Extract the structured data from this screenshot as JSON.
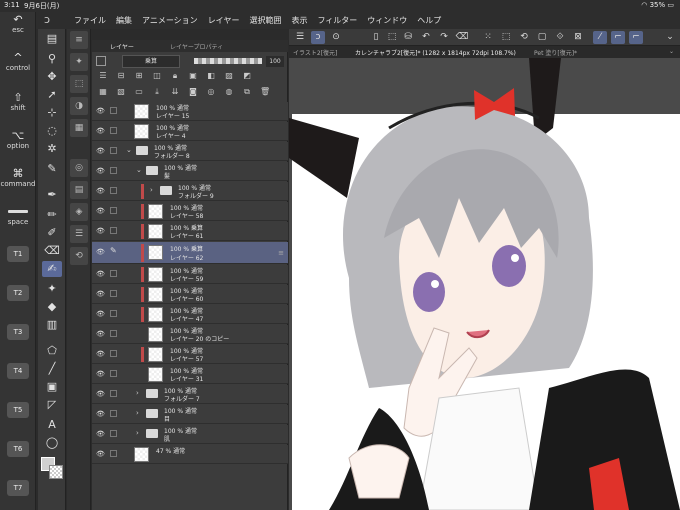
{
  "status_bar": {
    "time": "3:11",
    "date": "9月6日(月)",
    "battery": "35%"
  },
  "menubar": {
    "items": [
      "ファイル",
      "編集",
      "アニメーション",
      "レイヤー",
      "選択範囲",
      "表示",
      "フィルター",
      "ウィンドウ",
      "ヘルプ"
    ]
  },
  "shortcuts": {
    "esc": "esc",
    "control": "control",
    "shift": "shift",
    "option": "option",
    "command": "command",
    "space": "space",
    "t_buttons": [
      "T1",
      "T2",
      "T3",
      "T4",
      "T5",
      "T6",
      "T7"
    ]
  },
  "layer_panel": {
    "tabs": [
      "レイヤー",
      "レイヤープロパティ"
    ],
    "blend_mode": "乗算",
    "opacity": "100",
    "rows": [
      {
        "line1": "100 % 通常",
        "line2": "レイヤー 15",
        "type": "layer"
      },
      {
        "line1": "100 % 通常",
        "line2": "レイヤー 4",
        "type": "layer"
      },
      {
        "line1": "100 % 通常",
        "line2": "フォルダー 8",
        "type": "folder"
      },
      {
        "line1": "100 % 通常",
        "line2": "髪",
        "type": "folder"
      },
      {
        "line1": "100 % 通常",
        "line2": "フォルダー 9",
        "type": "folder"
      },
      {
        "line1": "100 % 通常",
        "line2": "レイヤー 58",
        "type": "layer"
      },
      {
        "line1": "100 % 乗算",
        "line2": "レイヤー 61",
        "type": "layer"
      },
      {
        "line1": "100 % 乗算",
        "line2": "レイヤー 62",
        "type": "layer",
        "selected": true
      },
      {
        "line1": "100 % 通常",
        "line2": "レイヤー 59",
        "type": "layer"
      },
      {
        "line1": "100 % 通常",
        "line2": "レイヤー 60",
        "type": "layer"
      },
      {
        "line1": "100 % 通常",
        "line2": "レイヤー 47",
        "type": "layer"
      },
      {
        "line1": "100 % 通常",
        "line2": "レイヤー 20 のコピー",
        "type": "layer"
      },
      {
        "line1": "100 % 通常",
        "line2": "レイヤー 57",
        "type": "layer"
      },
      {
        "line1": "100 % 通常",
        "line2": "レイヤー 31",
        "type": "layer"
      },
      {
        "line1": "100 % 通常",
        "line2": "フォルダー 7",
        "type": "folder"
      },
      {
        "line1": "100 % 通常",
        "line2": "目",
        "type": "folder"
      },
      {
        "line1": "100 % 通常",
        "line2": "肌",
        "type": "folder"
      },
      {
        "line1": "47 % 通常",
        "line2": "",
        "type": "layer"
      }
    ]
  },
  "doc_tabs": [
    "イラスト2[復元]",
    "カレンチャラブ2[復元]* (1282 x 1814px 72dpi 108.7%)",
    "Pet 塗り[復元]*"
  ],
  "colors": {
    "accent": "#5a6282",
    "clip_marker": "#c04a4a",
    "ribbon": "#e0322a",
    "ears": "#1e1a1a",
    "hair": "#b9b9bd",
    "eyes": "#8a6fb0"
  }
}
